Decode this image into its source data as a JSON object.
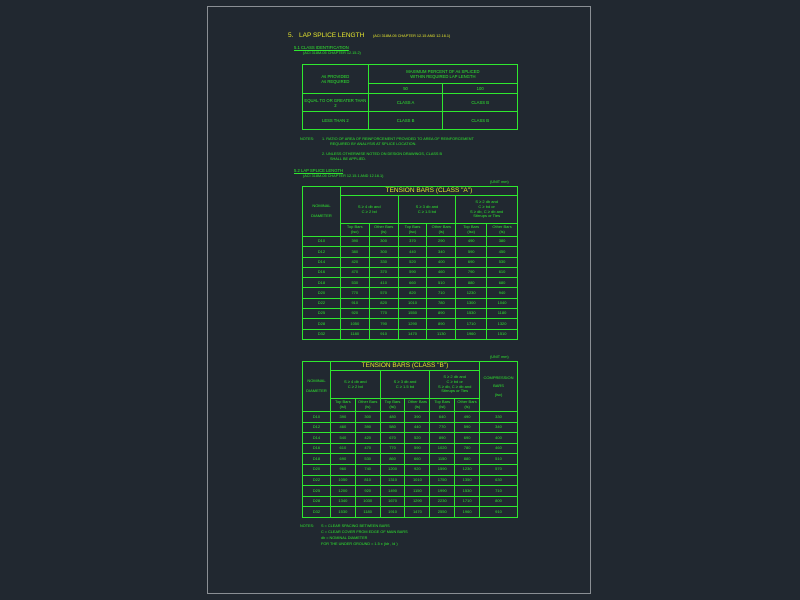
{
  "section": {
    "number": "5.",
    "title": "LAP SPLICE LENGTH",
    "ref": "(ACI 318M-05 CHAPTER 12.15 AND 12.16.1)"
  },
  "s51": {
    "title": "5.1 CLASS IDENTIFICATION",
    "ref": "(ACI 318M-05 CHAPTER 12.15.2)"
  },
  "class_table": {
    "head_left_1": "As PROVIDED",
    "head_left_2": "As REQUIRED",
    "head_right_1": "MAXIMUM PERCENT OF As SPLICED",
    "head_right_2": "WITHIN REQUIRED LAP LENGTH",
    "col1": "50",
    "col2": "100",
    "rows": [
      {
        "label": "EQUAL TO OR GREATER THAN 2",
        "a": "CLASS A",
        "b": "CLASS B"
      },
      {
        "label": "LESS THAN 2",
        "a": "CLASS B",
        "b": "CLASS B"
      }
    ]
  },
  "notes1": {
    "label": "NOTES:",
    "n1a": "1. RATIO OF AREA OF REINFORCEMENT PROVIDED TO AREA OF REINFORCEMENT",
    "n1b": "REQUIRED BY ANALYSIS AT SPLICE LOCATION.",
    "n2a": "2. UNLESS OTHERWISE NOTED ON DESIGN DRAWINGS, CLASS B",
    "n2b": "SHALL BE APPLIED."
  },
  "s52": {
    "title": "5.2 LAP SPLICE LENGTH",
    "ref": "(ACI 318M-05 CHAPTER 12.15.1 AND 12.16.1)"
  },
  "unit": "(UNIT mm)",
  "tableA": {
    "title": "TENSION BARS (CLASS \"A\")",
    "nominal_1": "NOMINAL",
    "nominal_2": "DIAMETER",
    "g1": "S ≥ 4 db  and\nC ≥ 2 bd",
    "g2": "S ≥ 3 db  and\nC ≥ 1.5 bd",
    "g3": "S ≥ 2 db  and\nC ≥ bd  or\nS ≥ db,  C ≥ db  and\nStirrups or Ties",
    "top": "Top Bars\n(lsc)",
    "other": "Other Bars\n(ls)",
    "rows": [
      [
        "D10",
        "390",
        "300",
        "370",
        "290",
        "490",
        "380"
      ],
      [
        "D12",
        "380",
        "300",
        "440",
        "340",
        "590",
        "450"
      ],
      [
        "D14",
        "420",
        "330",
        "520",
        "400",
        "690",
        "530"
      ],
      [
        "D16",
        "470",
        "370",
        "590",
        "460",
        "790",
        "610"
      ],
      [
        "D18",
        "530",
        "410",
        "660",
        "510",
        "880",
        "680"
      ],
      [
        "D20",
        "770",
        "570",
        "820",
        "710",
        "1230",
        "940"
      ],
      [
        "D22",
        "910",
        "820",
        "1010",
        "780",
        "1300",
        "1040"
      ],
      [
        "D25",
        "920",
        "770",
        "1550",
        "890",
        "1530",
        "1180"
      ],
      [
        "D28",
        "1050",
        "790",
        "1290",
        "890",
        "1710",
        "1320"
      ],
      [
        "D32",
        "1180",
        "910",
        "1470",
        "1130",
        "1960",
        "1510"
      ]
    ]
  },
  "tableB": {
    "title": "TENSION BARS (CLASS \"B\")",
    "nominal_1": "NOMINAL",
    "nominal_2": "DIAMETER",
    "g1": "S ≥ 4 db  and\nC ≥ 2 bd",
    "g2": "S ≥ 3 db  and\nC ≥ 1.5 bd",
    "g3": "S ≥ 2 db  and\nC ≥ bd  or\nS ≥ db,  C ≥ db  and\nStirrups or Ties",
    "comp_1": "COMPRESSION",
    "comp_2": "BARS",
    "comp_3": "(lsc)",
    "top": "Top Bars\n(lsl)",
    "other": "Other Bars\n(ls)",
    "rows": [
      [
        "D10",
        "390",
        "300",
        "480",
        "390",
        "640",
        "490",
        "330"
      ],
      [
        "D12",
        "460",
        "390",
        "580",
        "440",
        "770",
        "590",
        "340"
      ],
      [
        "D14",
        "540",
        "420",
        "670",
        "520",
        "890",
        "690",
        "400"
      ],
      [
        "D16",
        "610",
        "470",
        "770",
        "590",
        "1020",
        "780",
        "460"
      ],
      [
        "D18",
        "690",
        "530",
        "860",
        "660",
        "1150",
        "880",
        "510"
      ],
      [
        "D20",
        "960",
        "740",
        "1200",
        "920",
        "1590",
        "1230",
        "570"
      ],
      [
        "D22",
        "1050",
        "810",
        "1310",
        "1010",
        "1750",
        "1350",
        "630"
      ],
      [
        "D25",
        "1200",
        "920",
        "1490",
        "1150",
        "1990",
        "1530",
        "710"
      ],
      [
        "D28",
        "1340",
        "1030",
        "1670",
        "1290",
        "2230",
        "1710",
        "800"
      ],
      [
        "D32",
        "1530",
        "1180",
        "1910",
        "1470",
        "2550",
        "1960",
        "910"
      ]
    ]
  },
  "notes2": {
    "label": "NOTES:",
    "l1": "S   = CLEAR SPACING BETWEEN BARS",
    "l2": "C   = CLEAR COVER FROM EDGE OF MAIN BARS",
    "l3": "db  = NOMINAL DIAMETER",
    "l4": "FOR THE UNDER GROUND = 1.5 x (ldr , ld )"
  }
}
